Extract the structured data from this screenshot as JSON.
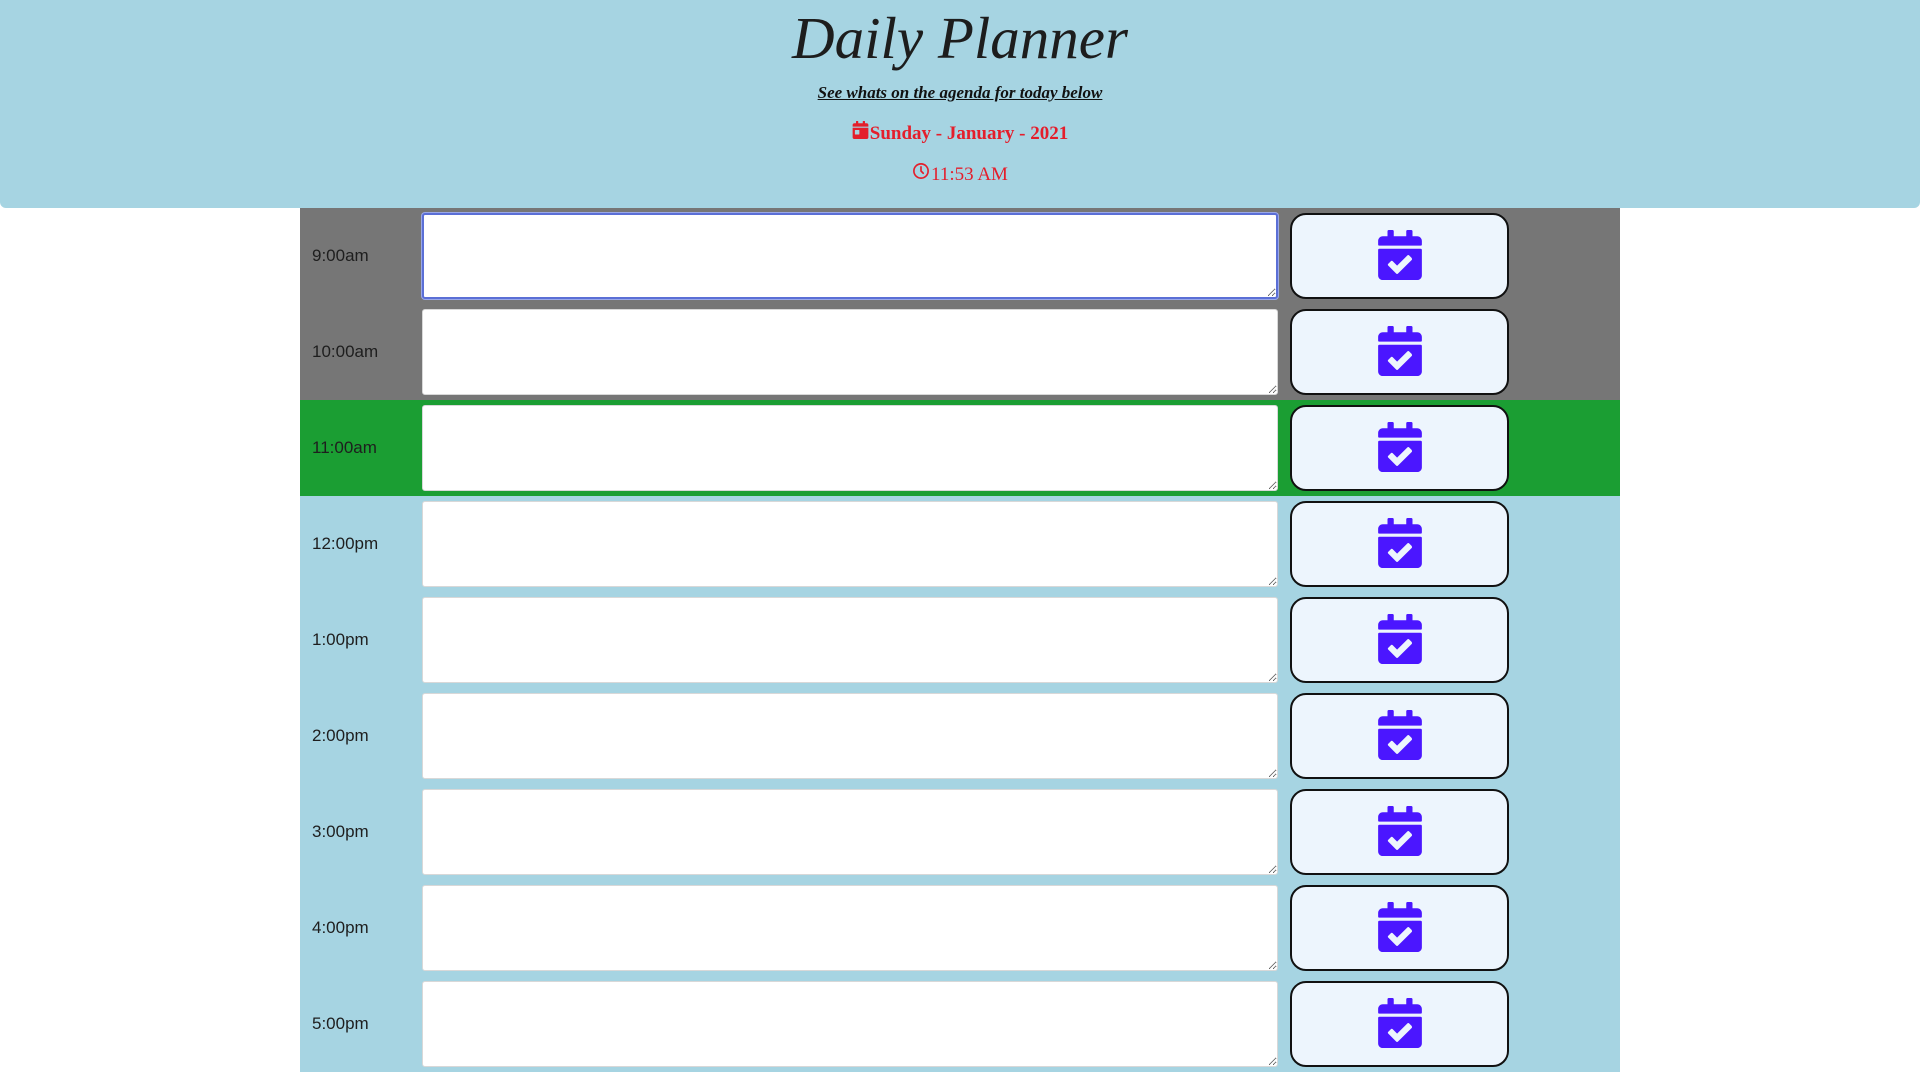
{
  "header": {
    "title": "Daily Planner",
    "subtitle": "See whats on the agenda for today below",
    "date": "Sunday - January - 2021",
    "time": "11:53 AM",
    "date_icon": "calendar-icon",
    "time_icon": "clock-icon"
  },
  "colors": {
    "header_bg": "#a6d4e2",
    "past": "#767676",
    "present": "#1b9e33",
    "future": "#a6d4e2",
    "accent_red": "#e41e2b",
    "save_icon": "#4b16ff"
  },
  "rows": [
    {
      "hour": "9:00am",
      "state": "past",
      "task": "",
      "save_icon": "calendar-check-icon"
    },
    {
      "hour": "10:00am",
      "state": "past",
      "task": "",
      "save_icon": "calendar-check-icon"
    },
    {
      "hour": "11:00am",
      "state": "present",
      "task": "",
      "save_icon": "calendar-check-icon"
    },
    {
      "hour": "12:00pm",
      "state": "future",
      "task": "",
      "save_icon": "calendar-check-icon"
    },
    {
      "hour": "1:00pm",
      "state": "future",
      "task": "",
      "save_icon": "calendar-check-icon"
    },
    {
      "hour": "2:00pm",
      "state": "future",
      "task": "",
      "save_icon": "calendar-check-icon"
    },
    {
      "hour": "3:00pm",
      "state": "future",
      "task": "",
      "save_icon": "calendar-check-icon"
    },
    {
      "hour": "4:00pm",
      "state": "future",
      "task": "",
      "save_icon": "calendar-check-icon"
    },
    {
      "hour": "5:00pm",
      "state": "future",
      "task": "",
      "save_icon": "calendar-check-icon"
    }
  ]
}
